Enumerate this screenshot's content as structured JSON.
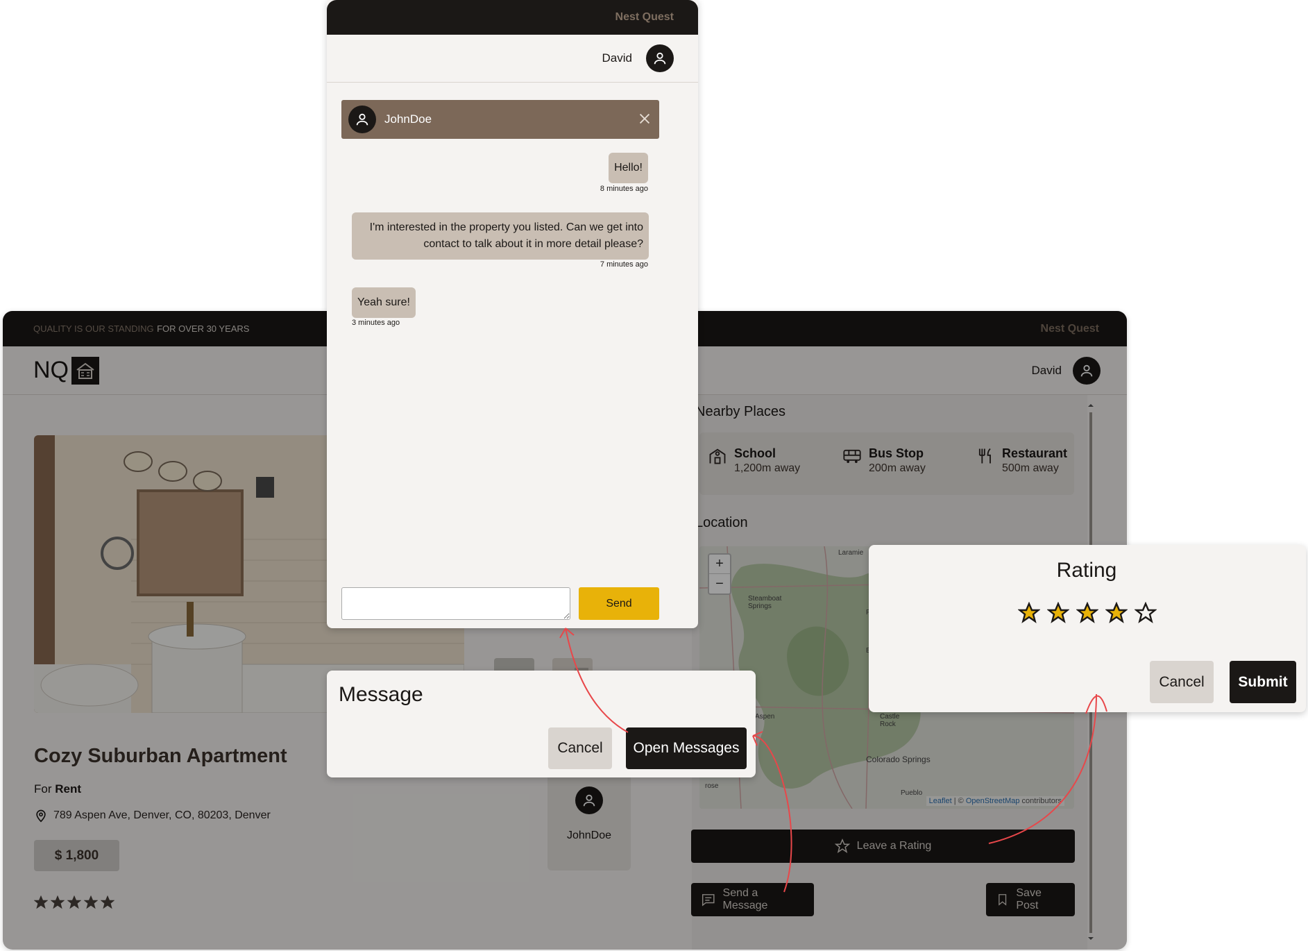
{
  "main": {
    "tagline_a": "QUALITY IS OUR STANDING",
    "tagline_b": "FOR OVER 30 YEARS",
    "brand": "Nest Quest",
    "logo_text": "NQ",
    "user_name": "David",
    "listing": {
      "title": "Cozy Suburban Apartment",
      "for_label": "For",
      "for_value": "Rent",
      "address": "789 Aspen Ave, Denver, CO, 80203, Denver",
      "price": "$ 1,800",
      "rating_stars": 5
    },
    "agent_name": "JohnDoe",
    "nearby_title": "Nearby Places",
    "nearby": [
      {
        "name": "School",
        "distance": "1,200m away",
        "icon": "school-icon"
      },
      {
        "name": "Bus Stop",
        "distance": "200m away",
        "icon": "bus-icon"
      },
      {
        "name": "Restaurant",
        "distance": "500m away",
        "icon": "restaurant-icon"
      }
    ],
    "location_title": "Location",
    "map": {
      "zoom_in": "+",
      "zoom_out": "−",
      "labels": [
        "Laramie",
        "Steamboat Springs",
        "Aspen",
        "Castle Rock",
        "Colorado Springs",
        "Pueblo",
        "rose",
        "Fo",
        "Boul"
      ],
      "attrib_leaflet": "Leaflet",
      "attrib_sep": " | © ",
      "attrib_osm": "OpenStreetMap",
      "attrib_tail": " contributors"
    },
    "buttons": {
      "leave_rating": "Leave a Rating",
      "send_message": "Send a Message",
      "save_post": "Save Post"
    }
  },
  "chat": {
    "brand": "Nest Quest",
    "user_name": "David",
    "contact": "JohnDoe",
    "messages": [
      {
        "text": "Hello!",
        "time": "8 minutes ago",
        "side": "right"
      },
      {
        "text": "I'm interested in the property you listed. Can we get into contact to talk about it in more detail please?",
        "time": "7 minutes ago",
        "side": "right"
      },
      {
        "text": "Yeah sure!",
        "time": "3 minutes ago",
        "side": "left"
      }
    ],
    "input_value": "",
    "send_label": "Send"
  },
  "message_dialog": {
    "title": "Message",
    "cancel": "Cancel",
    "open": "Open Messages"
  },
  "rating_dialog": {
    "title": "Rating",
    "stars_filled": 4,
    "stars_total": 5,
    "cancel": "Cancel",
    "submit": "Submit"
  },
  "colors": {
    "dark": "#1b1816",
    "accent": "#e8b209",
    "contact_bar": "#7c6858",
    "bubble": "#c9beb3",
    "arrow": "#e8474a"
  }
}
